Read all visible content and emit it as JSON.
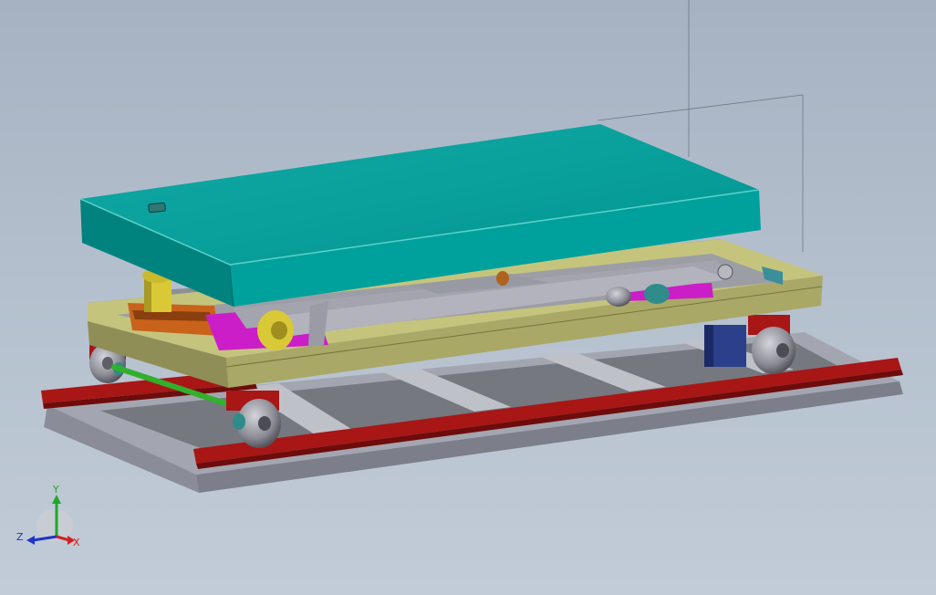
{
  "viewport": {
    "background_top": "#a6b2c2",
    "background_bottom": "#c2ccd8"
  },
  "model": {
    "components": [
      {
        "name": "lift-platform",
        "color": "#00a19c"
      },
      {
        "name": "base-rail",
        "color": "#a81616"
      },
      {
        "name": "carriage-frame",
        "color": "#a9a867"
      },
      {
        "name": "scissor-arm",
        "color": "#a3a4ae"
      },
      {
        "name": "ground-frame",
        "color": "#9da0ab"
      },
      {
        "name": "hydraulic-cylinder",
        "color": "#d9c936"
      },
      {
        "name": "cylinder-mount",
        "color": "#c9621a"
      },
      {
        "name": "magenta-link",
        "color": "#cc1ec8"
      },
      {
        "name": "motor-block",
        "color": "#2b3f8a"
      },
      {
        "name": "drive-shaft",
        "color": "#32b02c"
      },
      {
        "name": "wheel",
        "color": "#808089"
      }
    ]
  },
  "triad": {
    "x_label": "X",
    "y_label": "Y",
    "z_label": "Z",
    "x_color": "#d42020",
    "y_color": "#1ea82a",
    "z_color": "#2034c8"
  }
}
